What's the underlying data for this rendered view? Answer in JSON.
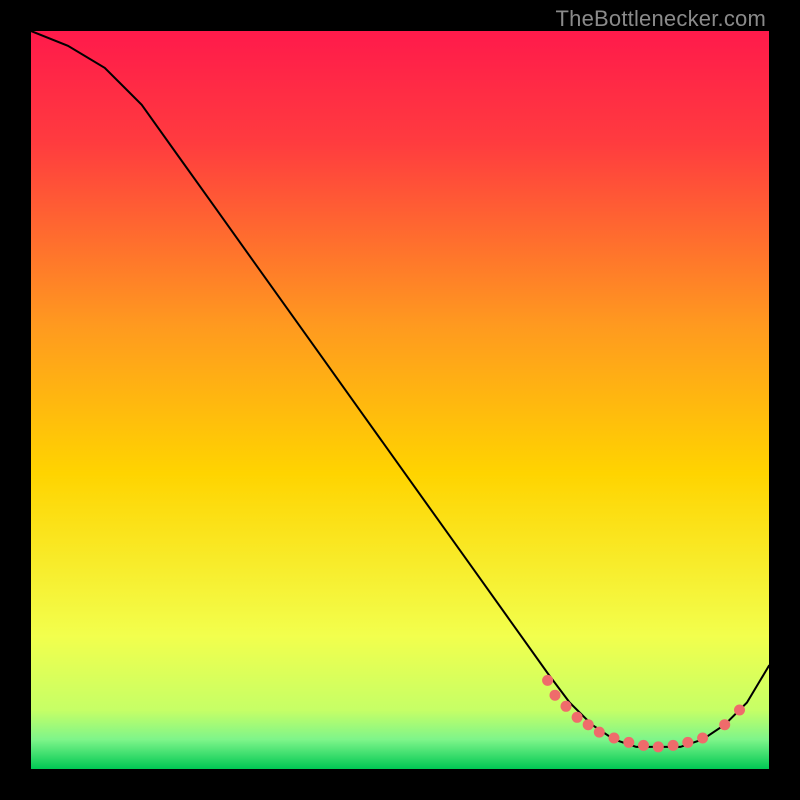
{
  "watermark": "TheBottlenecker.com",
  "chart_data": {
    "type": "line",
    "title": "",
    "xlabel": "",
    "ylabel": "",
    "xlim": [
      0,
      100
    ],
    "ylim": [
      0,
      100
    ],
    "background_gradient": {
      "top": "#ff1a4b",
      "mid": "#ffd400",
      "bottom": "#00c853"
    },
    "series": [
      {
        "name": "curve",
        "x": [
          0,
          5,
          10,
          15,
          20,
          25,
          30,
          35,
          40,
          45,
          50,
          55,
          60,
          65,
          70,
          73,
          76,
          79,
          82,
          85,
          88,
          91,
          94,
          97,
          100
        ],
        "y": [
          100,
          98,
          95,
          90,
          83,
          76,
          69,
          62,
          55,
          48,
          41,
          34,
          27,
          20,
          13,
          9,
          6,
          4,
          3,
          3,
          3,
          4,
          6,
          9,
          14
        ]
      }
    ],
    "markers": {
      "name": "highlight-markers",
      "color": "#ef6b6b",
      "x": [
        70,
        71,
        72.5,
        74,
        75.5,
        77,
        79,
        81,
        83,
        85,
        87,
        89,
        91,
        94,
        96
      ],
      "y": [
        12,
        10,
        8.5,
        7,
        6,
        5,
        4.2,
        3.6,
        3.2,
        3,
        3.2,
        3.6,
        4.2,
        6,
        8
      ]
    }
  }
}
